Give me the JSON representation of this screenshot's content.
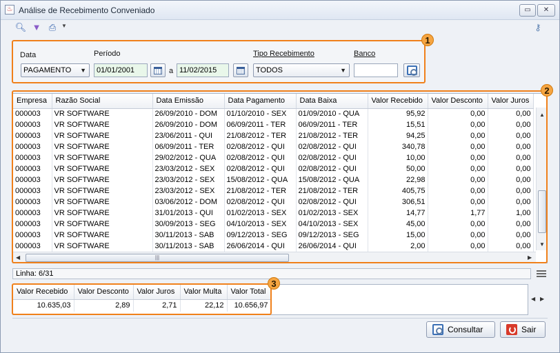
{
  "window": {
    "title": "Análise de Recebimento Conveniado"
  },
  "toolbar": {
    "icons": [
      "search-icon",
      "filter-icon",
      "print-icon",
      "dropdown-arrow-icon",
      "key-icon"
    ]
  },
  "filters": {
    "badge": "1",
    "data_label": "Data",
    "data_value": "PAGAMENTO",
    "periodo_label": "Período",
    "periodo_start": "01/01/2001",
    "periodo_separator": "a",
    "periodo_end": "11/02/2015",
    "tipo_label": "Tipo Recebimento",
    "tipo_value": "TODOS",
    "banco_label": "Banco",
    "banco_value": ""
  },
  "grid": {
    "badge": "2",
    "columns": [
      "Empresa",
      "Razão Social",
      "Data Emissão",
      "Data Pagamento",
      "Data Baixa",
      "Valor Recebido",
      "Valor Desconto",
      "Valor Juros"
    ],
    "rows": [
      [
        "000003",
        "VR SOFTWARE",
        "26/09/2010 - DOM",
        "01/10/2010 - SEX",
        "01/09/2010 - QUA",
        "95,92",
        "0,00",
        "0,00"
      ],
      [
        "000003",
        "VR SOFTWARE",
        "26/09/2010 - DOM",
        "06/09/2011 - TER",
        "06/09/2011 - TER",
        "15,51",
        "0,00",
        "0,00"
      ],
      [
        "000003",
        "VR SOFTWARE",
        "23/06/2011 - QUI",
        "21/08/2012 - TER",
        "21/08/2012 - TER",
        "94,25",
        "0,00",
        "0,00"
      ],
      [
        "000003",
        "VR SOFTWARE",
        "06/09/2011 - TER",
        "02/08/2012 - QUI",
        "02/08/2012 - QUI",
        "340,78",
        "0,00",
        "0,00"
      ],
      [
        "000003",
        "VR SOFTWARE",
        "29/02/2012 - QUA",
        "02/08/2012 - QUI",
        "02/08/2012 - QUI",
        "10,00",
        "0,00",
        "0,00"
      ],
      [
        "000003",
        "VR SOFTWARE",
        "23/03/2012 - SEX",
        "02/08/2012 - QUI",
        "02/08/2012 - QUI",
        "50,00",
        "0,00",
        "0,00"
      ],
      [
        "000003",
        "VR SOFTWARE",
        "23/03/2012 - SEX",
        "15/08/2012 - QUA",
        "15/08/2012 - QUA",
        "22,98",
        "0,00",
        "0,00"
      ],
      [
        "000003",
        "VR SOFTWARE",
        "23/03/2012 - SEX",
        "21/08/2012 - TER",
        "21/08/2012 - TER",
        "405,75",
        "0,00",
        "0,00"
      ],
      [
        "000003",
        "VR SOFTWARE",
        "03/06/2012 - DOM",
        "02/08/2012 - QUI",
        "02/08/2012 - QUI",
        "306,51",
        "0,00",
        "0,00"
      ],
      [
        "000003",
        "VR SOFTWARE",
        "31/01/2013 - QUI",
        "01/02/2013 - SEX",
        "01/02/2013 - SEX",
        "14,77",
        "1,77",
        "1,00"
      ],
      [
        "000003",
        "VR SOFTWARE",
        "30/09/2013 - SEG",
        "04/10/2013 - SEX",
        "04/10/2013 - SEX",
        "45,00",
        "0,00",
        "0,00"
      ],
      [
        "000003",
        "VR SOFTWARE",
        "30/11/2013 - SAB",
        "09/12/2013 - SEG",
        "09/12/2013 - SEG",
        "15,00",
        "0,00",
        "0,00"
      ],
      [
        "000003",
        "VR SOFTWARE",
        "30/11/2013 - SAB",
        "26/06/2014 - QUI",
        "26/06/2014 - QUI",
        "2,00",
        "0,00",
        "0,00"
      ]
    ]
  },
  "status": {
    "linha": "Linha: 6/31"
  },
  "totals": {
    "badge": "3",
    "columns": [
      "Valor Recebido",
      "Valor Desconto",
      "Valor Juros",
      "Valor Multa",
      "Valor Total"
    ],
    "values": [
      "10.635,03",
      "2,89",
      "2,71",
      "22,12",
      "10.656,97"
    ]
  },
  "buttons": {
    "consultar": "Consultar",
    "sair": "Sair"
  },
  "colors": {
    "highlight": "#f0801a",
    "badge": "#f6a541",
    "date_field": "#e9f7ea"
  }
}
